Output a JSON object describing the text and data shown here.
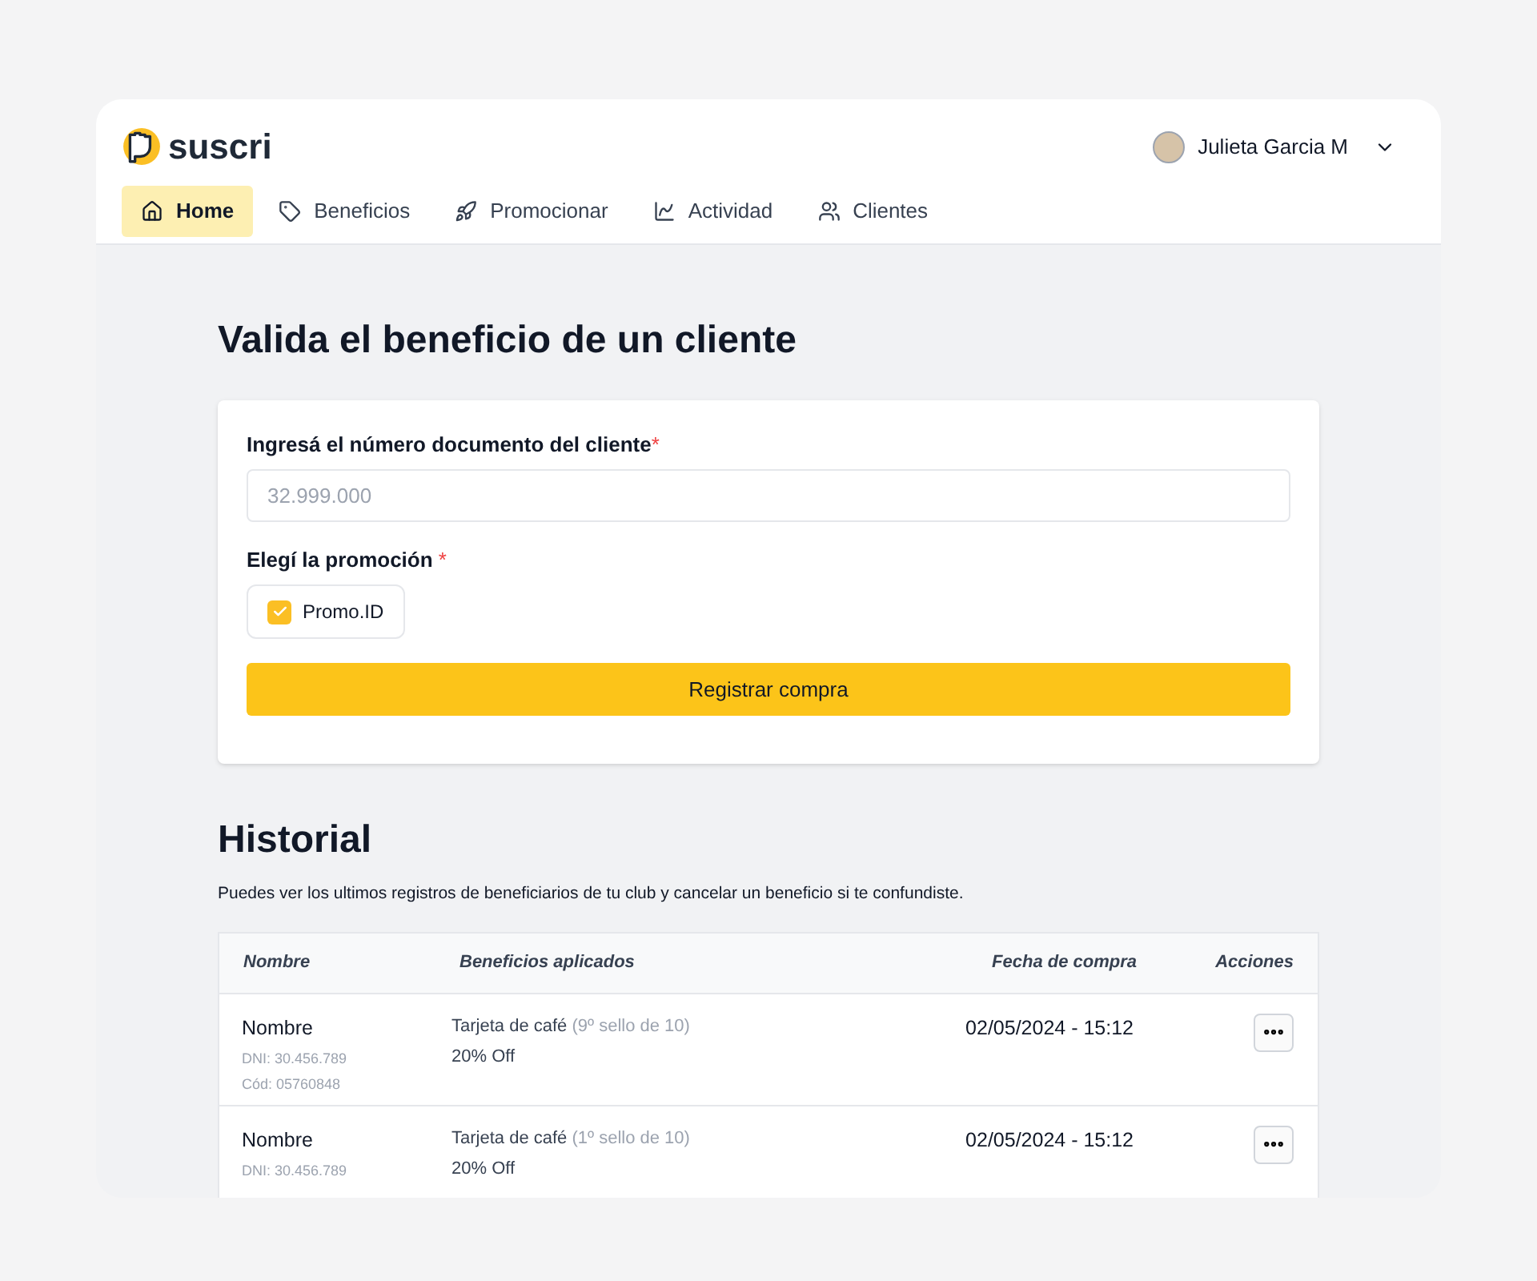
{
  "brand": {
    "name": "suscri"
  },
  "user": {
    "name": "Julieta Garcia M"
  },
  "nav": [
    {
      "label": "Home",
      "kind": "home",
      "selected": true
    },
    {
      "label": "Beneficios",
      "kind": "tag",
      "selected": false
    },
    {
      "label": "Promocionar",
      "kind": "rocket",
      "selected": false
    },
    {
      "label": "Actividad",
      "kind": "chart",
      "selected": false
    },
    {
      "label": "Clientes",
      "kind": "users",
      "selected": false
    }
  ],
  "validate": {
    "title": "Valida el beneficio de un cliente",
    "document_label": "Ingresá el número documento del cliente",
    "required_mark": "*",
    "document_placeholder": "32.999.000",
    "promo_label": "Elegí la promoción",
    "promo_required_mark": "*",
    "promos": [
      {
        "label": "Promo.ID",
        "checked": true
      }
    ],
    "submit": "Registrar compra"
  },
  "history": {
    "title": "Historial",
    "description": "Puedes ver los ultimos registros de beneficiarios de tu club y cancelar un beneficio si te confundiste.",
    "columns": [
      "Nombre",
      "Beneficios aplicados",
      "Fecha de compra",
      "Acciones"
    ],
    "rows": [
      {
        "name": "Nombre",
        "dni": "DNI: 30.456.789",
        "code": "Cód: 05760848",
        "benefit": "Tarjeta de café",
        "stamp": "(9º sello de 10)",
        "discount": "20% Off",
        "date": "02/05/2024 - 15:12"
      },
      {
        "name": "Nombre",
        "dni": "DNI: 30.456.789",
        "benefit": "Tarjeta de café",
        "stamp": "(1º sello de 10)",
        "discount": "20% Off",
        "date": "02/05/2024 - 15:12"
      }
    ]
  }
}
